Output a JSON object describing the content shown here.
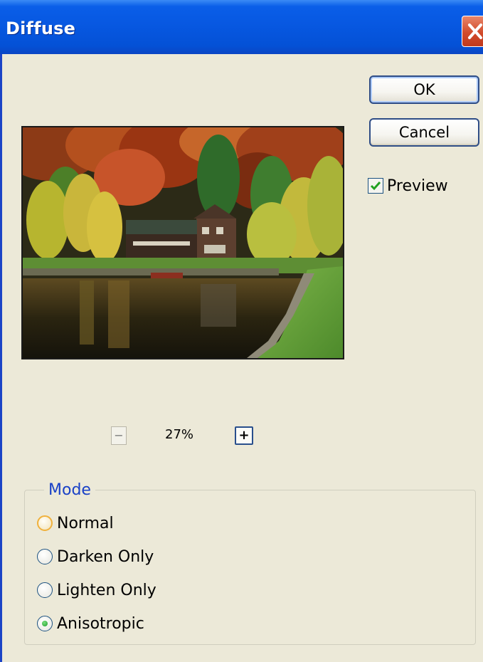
{
  "dialog": {
    "title": "Diffuse"
  },
  "buttons": {
    "ok_label": "OK",
    "cancel_label": "Cancel"
  },
  "preview": {
    "label": "Preview",
    "checked": true
  },
  "zoom": {
    "level": "27%",
    "minus_symbol": "−",
    "plus_symbol": "+"
  },
  "mode": {
    "legend": "Mode",
    "options": [
      {
        "label": "Normal",
        "selected": false,
        "focused": true
      },
      {
        "label": "Darken Only",
        "selected": false
      },
      {
        "label": "Lighten Only",
        "selected": false
      },
      {
        "label": "Anisotropic",
        "selected": true
      }
    ]
  },
  "colors": {
    "titlebar": "#0757e0",
    "dialog_bg": "#ece9d8",
    "legend_text": "#1941c7",
    "check_green": "#21a121"
  },
  "icons": {
    "close": "close-icon",
    "checkmark": "checkmark-icon",
    "zoom_out": "zoom-out-icon",
    "zoom_in": "zoom-in-icon"
  }
}
